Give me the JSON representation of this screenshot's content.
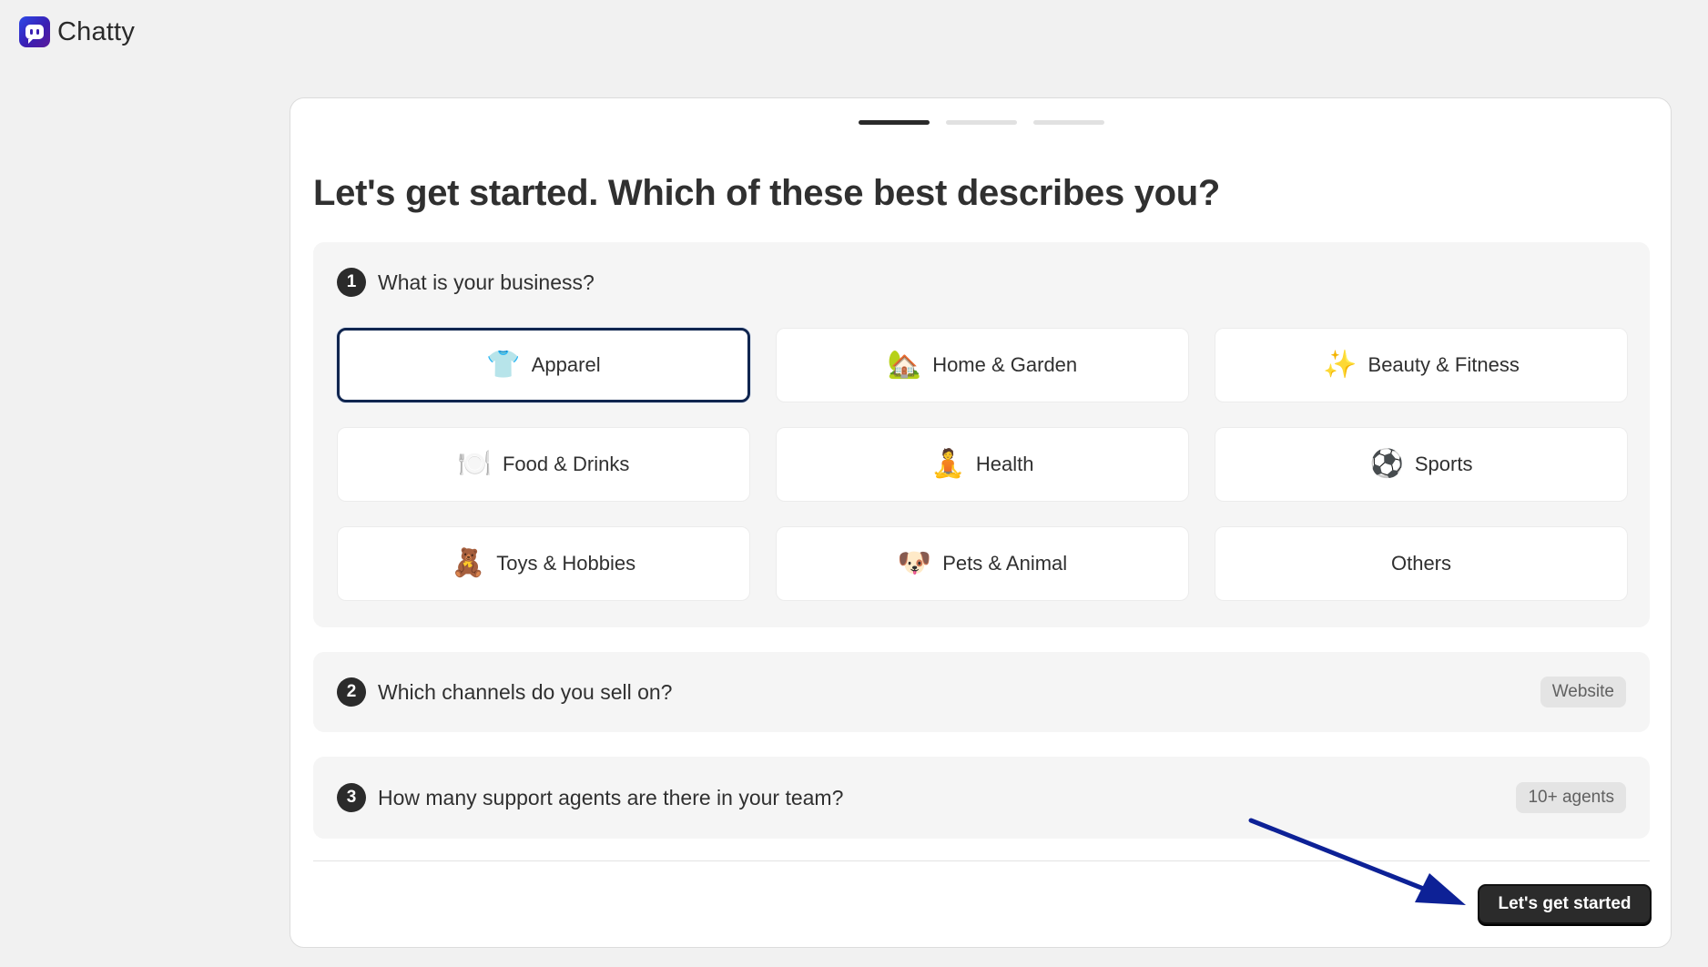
{
  "brand": {
    "name": "Chatty",
    "icon": "chat-bubble-icon"
  },
  "progress": {
    "current_step": 1,
    "total_steps": 3
  },
  "title": "Let's get started. Which of these best describes you?",
  "sections": [
    {
      "number": "1",
      "question": "What is your business?",
      "options": [
        {
          "emoji": "👕",
          "label": "Apparel",
          "selected": true
        },
        {
          "emoji": "🏡",
          "label": "Home & Garden",
          "selected": false
        },
        {
          "emoji": "✨",
          "label": "Beauty & Fitness",
          "selected": false
        },
        {
          "emoji": "🍽️",
          "label": "Food & Drinks",
          "selected": false
        },
        {
          "emoji": "🧘",
          "label": "Health",
          "selected": false
        },
        {
          "emoji": "⚽",
          "label": "Sports",
          "selected": false
        },
        {
          "emoji": "🧸",
          "label": "Toys & Hobbies",
          "selected": false
        },
        {
          "emoji": "🐶",
          "label": "Pets & Animal",
          "selected": false
        },
        {
          "emoji": "",
          "label": "Others",
          "selected": false
        }
      ]
    },
    {
      "number": "2",
      "question": "Which channels do you sell on?",
      "answer": "Website"
    },
    {
      "number": "3",
      "question": "How many support agents are there in your team?",
      "answer": "10+ agents"
    }
  ],
  "cta_label": "Let's get started",
  "colors": {
    "accent": "#10254f",
    "annotation_arrow": "#0d2196",
    "button": "#2b2b2b"
  }
}
